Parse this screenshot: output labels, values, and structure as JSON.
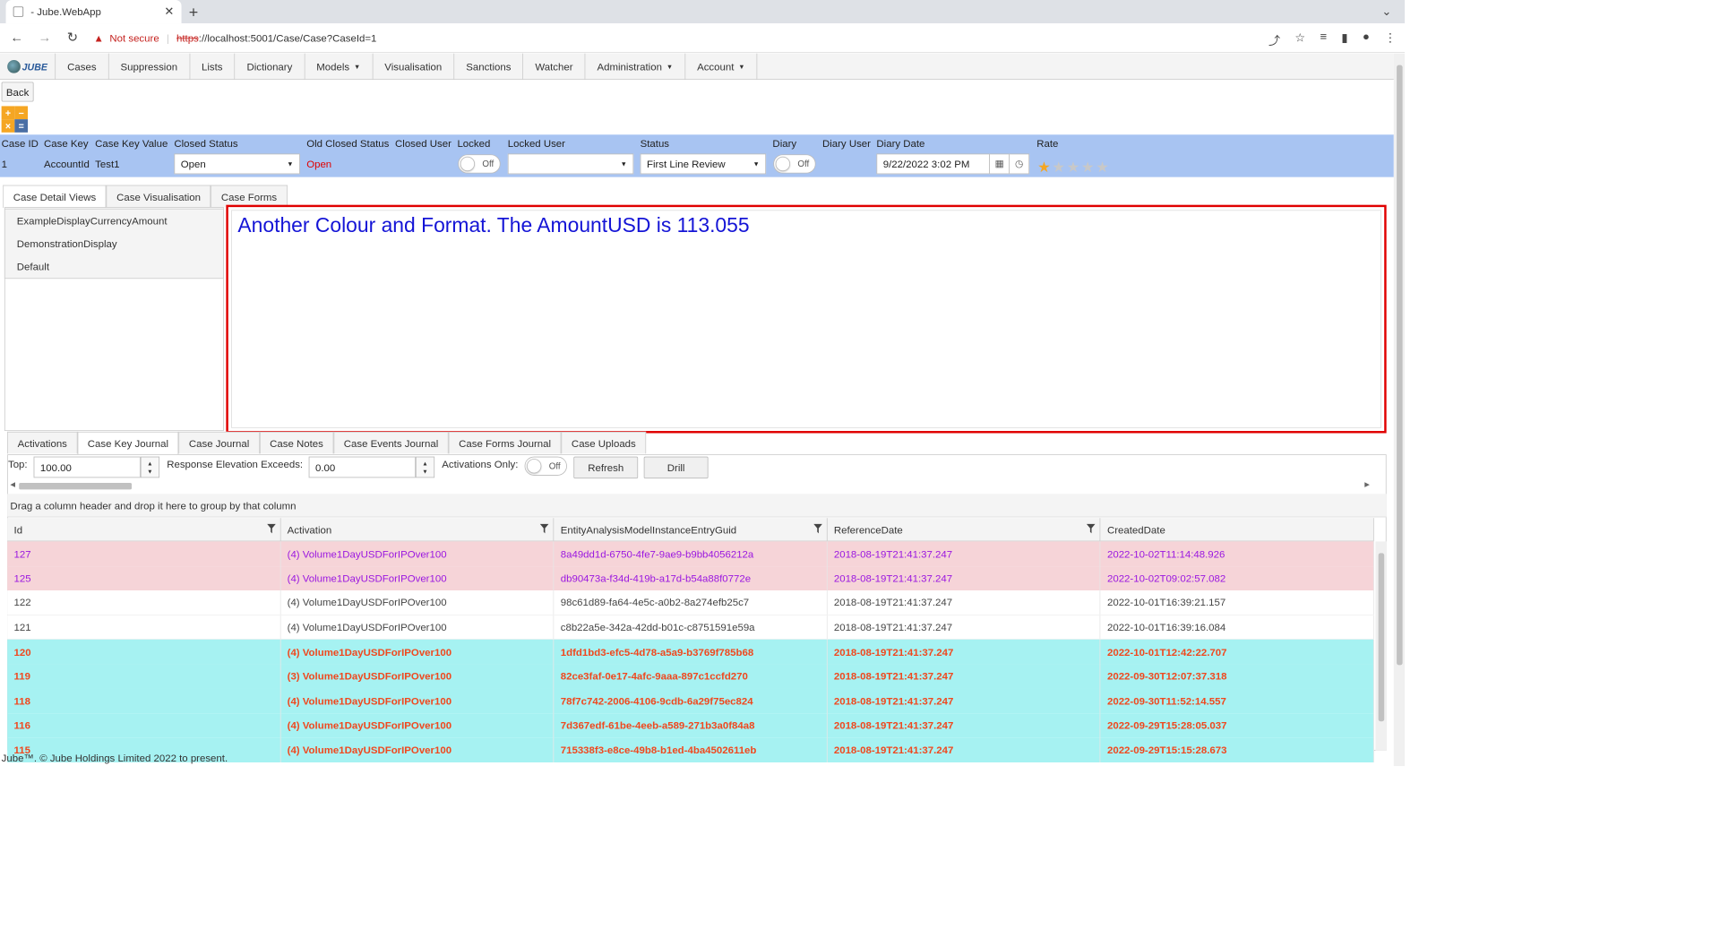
{
  "browser": {
    "tab_title": "- Jube.WebApp",
    "not_secure": "Not secure",
    "url_scheme": "https",
    "url_rest": "://localhost:5001/Case/Case?CaseId=1"
  },
  "nav": {
    "logo": "JUBE",
    "items": [
      "Cases",
      "Suppression",
      "Lists",
      "Dictionary",
      "Models",
      "Visualisation",
      "Sanctions",
      "Watcher",
      "Administration",
      "Account"
    ]
  },
  "back_label": "Back",
  "case_header": {
    "labels": [
      "Case ID",
      "Case Key",
      "Case Key Value",
      "Closed Status",
      "Old Closed Status",
      "Closed User",
      "Locked",
      "Locked User",
      "Status",
      "Diary",
      "Diary User",
      "Diary Date",
      "Rate"
    ],
    "case_id": "1",
    "case_key": "AccountId",
    "case_key_value": "Test1",
    "closed_status": "Open",
    "old_closed_status": "Open",
    "locked_toggle": "Off",
    "locked_user": "",
    "status": "First Line Review",
    "diary_toggle": "Off",
    "diary_date": "9/22/2022 3:02 PM",
    "rate": 1
  },
  "detail_tabs": [
    "Case Detail Views",
    "Case Visualisation",
    "Case Forms"
  ],
  "views": [
    "ExampleDisplayCurrencyAmount",
    "DemonstrationDisplay",
    "Default"
  ],
  "display_text": "Another Colour and Format. The AmountUSD is 113.055",
  "journal_tabs": [
    "Activations",
    "Case Key Journal",
    "Case Journal",
    "Case Notes",
    "Case Events Journal",
    "Case Forms Journal",
    "Case Uploads"
  ],
  "filters": {
    "top_label": "Top:",
    "top_value": "100.00",
    "response_label": "Response Elevation Exceeds:",
    "response_value": "0.00",
    "activations_label": "Activations Only:",
    "activations_toggle": "Off",
    "refresh": "Refresh",
    "drill": "Drill"
  },
  "group_hint": "Drag a column header and drop it here to group by that column",
  "grid": {
    "columns": [
      "Id",
      "Activation",
      "EntityAnalysisModelInstanceEntryGuid",
      "ReferenceDate",
      "CreatedDate"
    ],
    "rows": [
      {
        "id": "127",
        "activation": "(4) Volume1DayUSDForIPOver100",
        "guid": "8a49dd1d-6750-4fe7-9ae9-b9bb4056212a",
        "ref": "2018-08-19T21:41:37.247",
        "created": "2022-10-02T11:14:48.926",
        "style": "pink"
      },
      {
        "id": "125",
        "activation": "(4) Volume1DayUSDForIPOver100",
        "guid": "db90473a-f34d-419b-a17d-b54a88f0772e",
        "ref": "2018-08-19T21:41:37.247",
        "created": "2022-10-02T09:02:57.082",
        "style": "pink"
      },
      {
        "id": "122",
        "activation": "(4) Volume1DayUSDForIPOver100",
        "guid": "98c61d89-fa64-4e5c-a0b2-8a274efb25c7",
        "ref": "2018-08-19T21:41:37.247",
        "created": "2022-10-01T16:39:21.157",
        "style": "plain"
      },
      {
        "id": "121",
        "activation": "(4) Volume1DayUSDForIPOver100",
        "guid": "c8b22a5e-342a-42dd-b01c-c8751591e59a",
        "ref": "2018-08-19T21:41:37.247",
        "created": "2022-10-01T16:39:16.084",
        "style": "plain"
      },
      {
        "id": "120",
        "activation": "(4) Volume1DayUSDForIPOver100",
        "guid": "1dfd1bd3-efc5-4d78-a5a9-b3769f785b68",
        "ref": "2018-08-19T21:41:37.247",
        "created": "2022-10-01T12:42:22.707",
        "style": "cyan"
      },
      {
        "id": "119",
        "activation": "(3) Volume1DayUSDForIPOver100",
        "guid": "82ce3faf-0e17-4afc-9aaa-897c1ccfd270",
        "ref": "2018-08-19T21:41:37.247",
        "created": "2022-09-30T12:07:37.318",
        "style": "cyan"
      },
      {
        "id": "118",
        "activation": "(4) Volume1DayUSDForIPOver100",
        "guid": "78f7c742-2006-4106-9cdb-6a29f75ec824",
        "ref": "2018-08-19T21:41:37.247",
        "created": "2022-09-30T11:52:14.557",
        "style": "cyan"
      },
      {
        "id": "116",
        "activation": "(4) Volume1DayUSDForIPOver100",
        "guid": "7d367edf-61be-4eeb-a589-271b3a0f84a8",
        "ref": "2018-08-19T21:41:37.247",
        "created": "2022-09-29T15:28:05.037",
        "style": "cyan"
      },
      {
        "id": "115",
        "activation": "(4) Volume1DayUSDForIPOver100",
        "guid": "715338f3-e8ce-49b8-b1ed-4ba4502611eb",
        "ref": "2018-08-19T21:41:37.247",
        "created": "2022-09-29T15:15:28.673",
        "style": "cyan"
      }
    ]
  },
  "footer": "Jube™. © Jube Holdings Limited 2022 to present.",
  "colors": {
    "case_bar": "#a8c4f2",
    "pink_row": "#f6d4d8",
    "pink_text": "#9b17e0",
    "cyan_row": "#a6f2f2",
    "cyan_text": "#f0481e",
    "display_text": "#1414d6",
    "frame": "#e00000"
  }
}
